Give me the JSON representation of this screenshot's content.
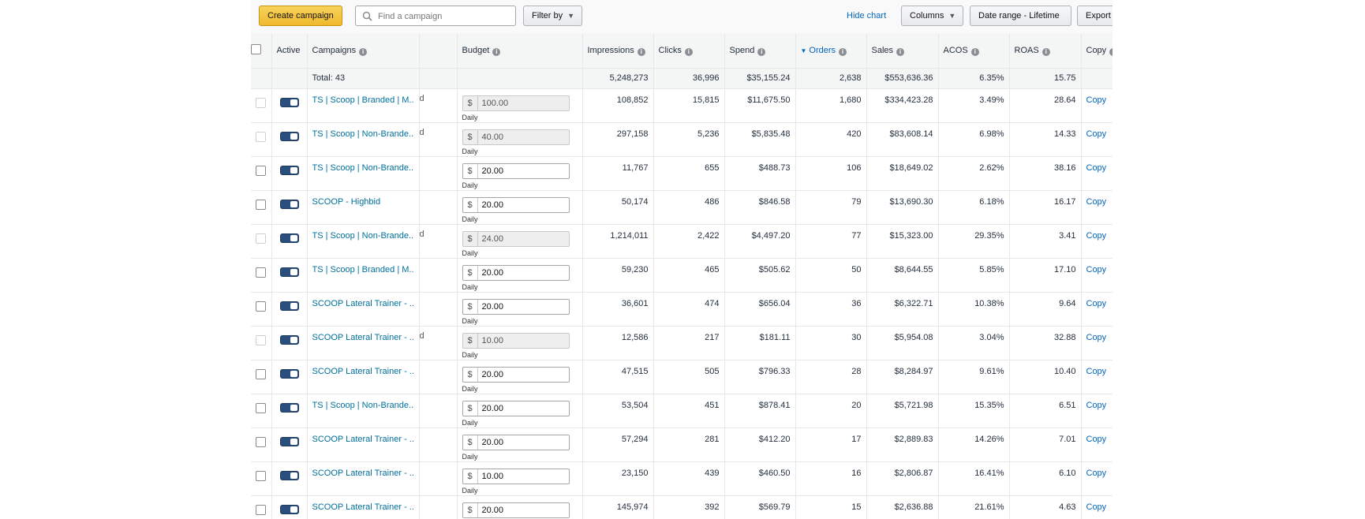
{
  "toolbar": {
    "create_label": "Create campaign",
    "search_placeholder": "Find a campaign",
    "filter_label": "Filter by",
    "hide_chart_label": "Hide chart",
    "columns_label": "Columns",
    "date_range_label": "Date range - Lifetime",
    "export_label": "Export"
  },
  "columns": {
    "active": "Active",
    "campaigns": "Campaigns",
    "budget": "Budget",
    "impressions": "Impressions",
    "clicks": "Clicks",
    "spend": "Spend",
    "orders": "Orders",
    "sales": "Sales",
    "acos": "ACOS",
    "roas": "ROAS",
    "copy": "Copy"
  },
  "total": {
    "label": "Total: 43",
    "impressions": "5,248,273",
    "clicks": "36,996",
    "spend": "$35,155.24",
    "orders": "2,638",
    "sales": "$553,636.36",
    "acos": "6.35%",
    "roas": "15.75"
  },
  "currency_symbol": "$",
  "budget_period": "Daily",
  "copy_label": "Copy",
  "rows": [
    {
      "name": "TS | Scoop | Branded | M...",
      "d": "d",
      "budget": "100.00",
      "budget_disabled": true,
      "impressions": "108,852",
      "clicks": "15,815",
      "spend": "$11,675.50",
      "orders": "1,680",
      "sales": "$334,423.28",
      "acos": "3.49%",
      "roas": "28.64",
      "checkbox_disabled": true
    },
    {
      "name": "TS | Scoop | Non-Brande...",
      "d": "d",
      "budget": "40.00",
      "budget_disabled": true,
      "impressions": "297,158",
      "clicks": "5,236",
      "spend": "$5,835.48",
      "orders": "420",
      "sales": "$83,608.14",
      "acos": "6.98%",
      "roas": "14.33",
      "checkbox_disabled": true
    },
    {
      "name": "TS | Scoop | Non-Brande...",
      "d": "",
      "budget": "20.00",
      "budget_disabled": false,
      "impressions": "11,767",
      "clicks": "655",
      "spend": "$488.73",
      "orders": "106",
      "sales": "$18,649.02",
      "acos": "2.62%",
      "roas": "38.16",
      "checkbox_disabled": false
    },
    {
      "name": "SCOOP - Highbid",
      "d": "",
      "budget": "20.00",
      "budget_disabled": false,
      "impressions": "50,174",
      "clicks": "486",
      "spend": "$846.58",
      "orders": "79",
      "sales": "$13,690.30",
      "acos": "6.18%",
      "roas": "16.17",
      "checkbox_disabled": false
    },
    {
      "name": "TS | Scoop | Non-Brande...",
      "d": "d",
      "budget": "24.00",
      "budget_disabled": true,
      "impressions": "1,214,011",
      "clicks": "2,422",
      "spend": "$4,497.20",
      "orders": "77",
      "sales": "$15,323.00",
      "acos": "29.35%",
      "roas": "3.41",
      "checkbox_disabled": true
    },
    {
      "name": "TS | Scoop | Branded | M...",
      "d": "",
      "budget": "20.00",
      "budget_disabled": false,
      "impressions": "59,230",
      "clicks": "465",
      "spend": "$505.62",
      "orders": "50",
      "sales": "$8,644.55",
      "acos": "5.85%",
      "roas": "17.10",
      "checkbox_disabled": false
    },
    {
      "name": "SCOOP Lateral Trainer - ...",
      "d": "",
      "budget": "20.00",
      "budget_disabled": false,
      "impressions": "36,601",
      "clicks": "474",
      "spend": "$656.04",
      "orders": "36",
      "sales": "$6,322.71",
      "acos": "10.38%",
      "roas": "9.64",
      "checkbox_disabled": false
    },
    {
      "name": "SCOOP Lateral Trainer - ...",
      "d": "d",
      "budget": "10.00",
      "budget_disabled": true,
      "impressions": "12,586",
      "clicks": "217",
      "spend": "$181.11",
      "orders": "30",
      "sales": "$5,954.08",
      "acos": "3.04%",
      "roas": "32.88",
      "checkbox_disabled": true
    },
    {
      "name": "SCOOP Lateral Trainer - ...",
      "d": "",
      "budget": "20.00",
      "budget_disabled": false,
      "impressions": "47,515",
      "clicks": "505",
      "spend": "$796.33",
      "orders": "28",
      "sales": "$8,284.97",
      "acos": "9.61%",
      "roas": "10.40",
      "checkbox_disabled": false
    },
    {
      "name": "TS | Scoop | Non-Brande...",
      "d": "",
      "budget": "20.00",
      "budget_disabled": false,
      "impressions": "53,504",
      "clicks": "451",
      "spend": "$878.41",
      "orders": "20",
      "sales": "$5,721.98",
      "acos": "15.35%",
      "roas": "6.51",
      "checkbox_disabled": false
    },
    {
      "name": "SCOOP Lateral Trainer - ...",
      "d": "",
      "budget": "20.00",
      "budget_disabled": false,
      "impressions": "57,294",
      "clicks": "281",
      "spend": "$412.20",
      "orders": "17",
      "sales": "$2,889.83",
      "acos": "14.26%",
      "roas": "7.01",
      "checkbox_disabled": false
    },
    {
      "name": "SCOOP Lateral Trainer - ...",
      "d": "",
      "budget": "10.00",
      "budget_disabled": false,
      "impressions": "23,150",
      "clicks": "439",
      "spend": "$460.50",
      "orders": "16",
      "sales": "$2,806.87",
      "acos": "16.41%",
      "roas": "6.10",
      "checkbox_disabled": false
    },
    {
      "name": "SCOOP Lateral Trainer - ...",
      "d": "",
      "budget": "20.00",
      "budget_disabled": false,
      "impressions": "145,974",
      "clicks": "392",
      "spend": "$569.79",
      "orders": "15",
      "sales": "$2,636.88",
      "acos": "21.61%",
      "roas": "4.63",
      "checkbox_disabled": false
    }
  ],
  "colors": {
    "primary_button": "#f0b92d",
    "link": "#0066c0",
    "campaign_link": "#00709c",
    "toggle_on": "#2a4f7e",
    "header_bg": "#f4f5f5"
  },
  "icons": {
    "search": "search-icon",
    "info": "info-icon",
    "sort": "sort-desc-icon",
    "toggle": "toggle-icon"
  }
}
